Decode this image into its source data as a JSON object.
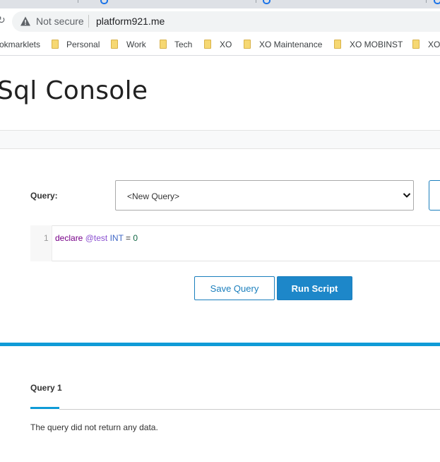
{
  "browser": {
    "security_text": "Not secure",
    "url": "platform921.me",
    "bookmarks": [
      "okmarklets",
      "Personal",
      "Work",
      "Tech",
      "XO",
      "XO Maintenance",
      "XO MOBINST",
      "XO"
    ]
  },
  "page": {
    "title": "Sql Console"
  },
  "query": {
    "label": "Query:",
    "selected": "<New Query>"
  },
  "editor": {
    "line_number": "1",
    "tokens": {
      "keyword": "declare",
      "variable": "@test",
      "type": "INT",
      "operator": "=",
      "number": "0"
    }
  },
  "actions": {
    "save_label": "Save Query",
    "run_label": "Run Script"
  },
  "results": {
    "tab_label": "Query 1",
    "message": "The query did not return any data."
  },
  "colors": {
    "accent": "#1d87c9",
    "divider": "#0f9bd7"
  }
}
